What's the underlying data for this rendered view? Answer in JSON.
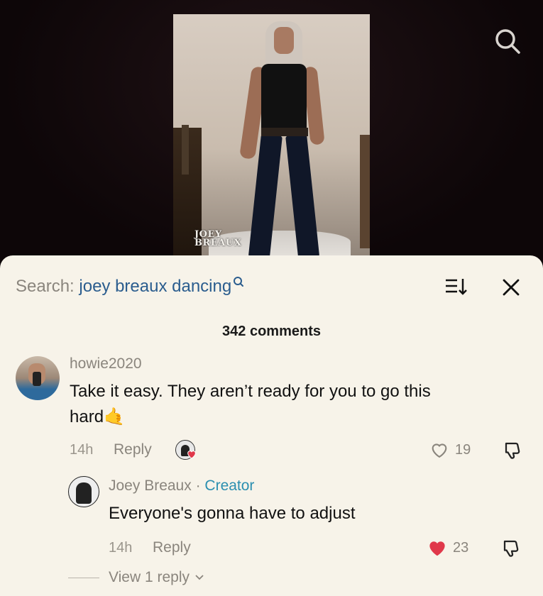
{
  "video": {
    "watermark_line1": "JOEY",
    "watermark_line2": "BREAUX"
  },
  "top_bar": {
    "search_icon": "search-icon"
  },
  "sheet": {
    "search_label": "Search:",
    "search_query": "joey breaux dancing",
    "sort_icon": "sort-icon",
    "close_icon": "close-icon",
    "comment_count": "342 comments"
  },
  "comments": [
    {
      "username": "howie2020",
      "text_line1": "Take it easy. They aren’t ready for you to go this",
      "text_line2": "hard",
      "emoji": "🤙",
      "time": "14h",
      "reply_label": "Reply",
      "likes": "19",
      "liked_by_creator": true
    }
  ],
  "replies": [
    {
      "username": "Joey Breaux",
      "separator": " · ",
      "badge": "Creator",
      "text": "Everyone's gonna have to adjust",
      "time": "14h",
      "reply_label": "Reply",
      "likes": "23",
      "liked": true
    }
  ],
  "view_replies": "View 1 reply",
  "colors": {
    "sheet_bg": "#f7f3e9",
    "link_blue": "#2b5d8e",
    "creator_teal": "#2b8fb0",
    "heart_red": "#e0384a"
  }
}
